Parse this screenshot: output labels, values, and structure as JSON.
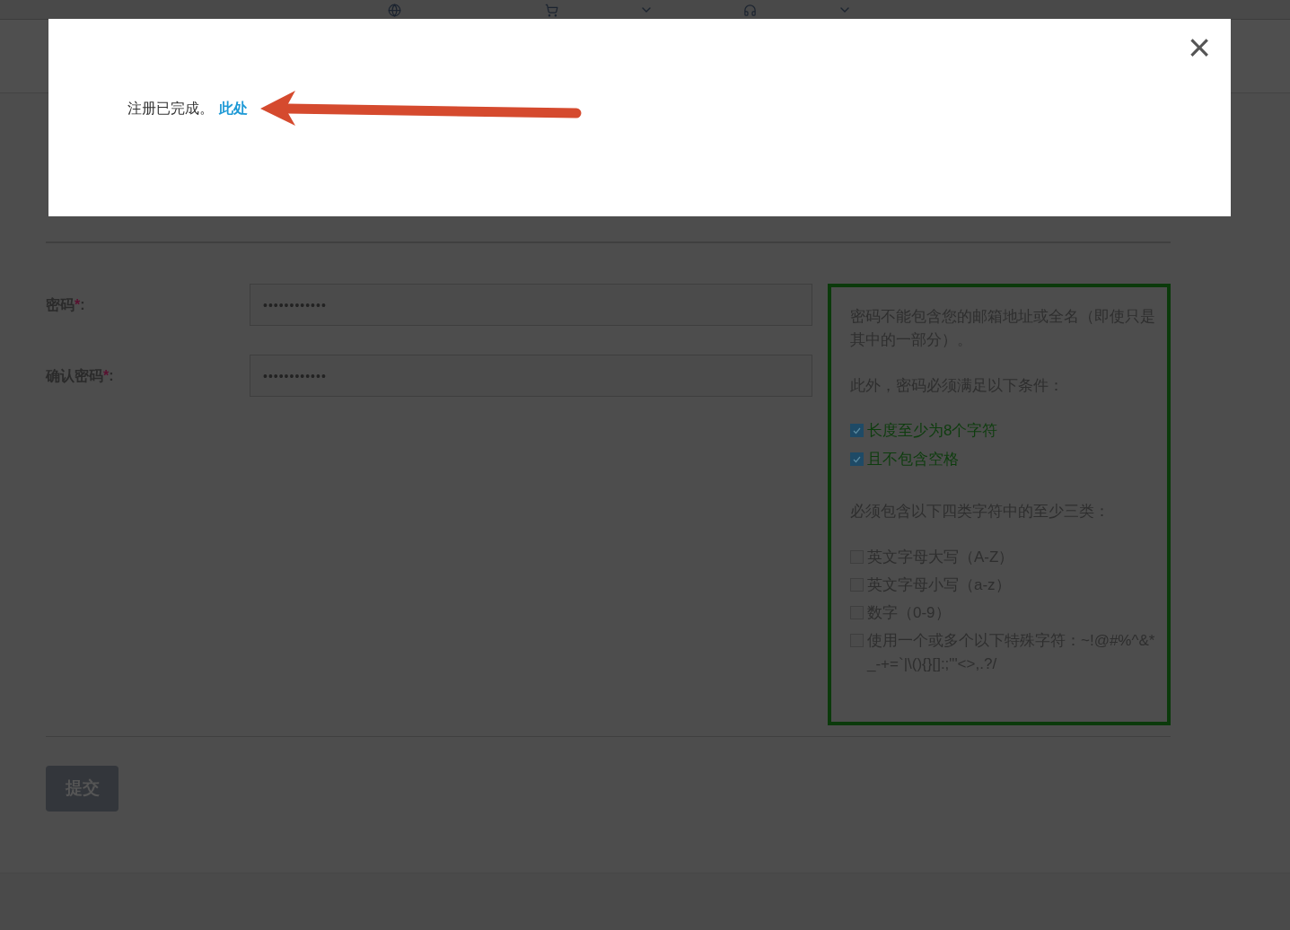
{
  "fields": [
    {
      "label": "密码",
      "required_mark": "*",
      "colon": ":",
      "value": "••••••••••••"
    },
    {
      "label": "确认密码",
      "required_mark": "*",
      "colon": ":",
      "value": "••••••••••••"
    }
  ],
  "rules": {
    "intro": "密码不能包含您的邮箱地址或全名（即使只是其中的一部分）。",
    "basic_title": "此外，密码必须满足以下条件：",
    "basic": [
      {
        "text": "长度至少为8个字符",
        "checked": true
      },
      {
        "text": "且不包含空格",
        "checked": true
      }
    ],
    "classes_title": "必须包含以下四类字符中的至少三类：",
    "classes": [
      {
        "text": "英文字母大写（A-Z）",
        "checked": false
      },
      {
        "text": "英文字母小写（a-z）",
        "checked": false
      },
      {
        "text": "数字（0-9）",
        "checked": false
      },
      {
        "text": "使用一个或多个以下特殊字符：~!@#%^&*_-+=`|\\(){}[]:;\"'<>,.?/",
        "checked": false
      }
    ]
  },
  "submit": {
    "label": "提交",
    "disabled": true
  },
  "modal": {
    "message": "注册已完成。",
    "link": "此处",
    "close": "×"
  }
}
